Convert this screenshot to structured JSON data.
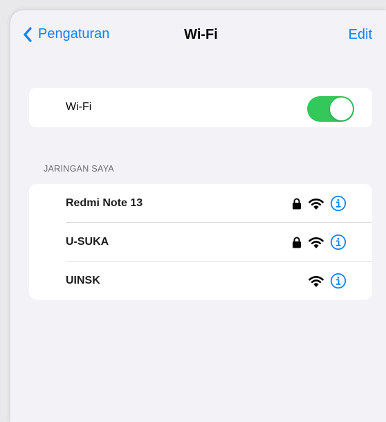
{
  "nav": {
    "back_label": "Pengaturan",
    "title": "Wi-Fi",
    "edit_label": "Edit"
  },
  "wifi_toggle": {
    "label": "Wi-Fi",
    "on": true
  },
  "my_networks": {
    "header": "JARINGAN SAYA",
    "items": [
      {
        "name": "Redmi Note 13",
        "locked": true
      },
      {
        "name": "U-SUKA",
        "locked": true
      },
      {
        "name": "UINSK",
        "locked": false
      }
    ]
  },
  "colors": {
    "accent": "#0a84ff",
    "toggle_on": "#34c759",
    "background": "#f2f2f7"
  }
}
